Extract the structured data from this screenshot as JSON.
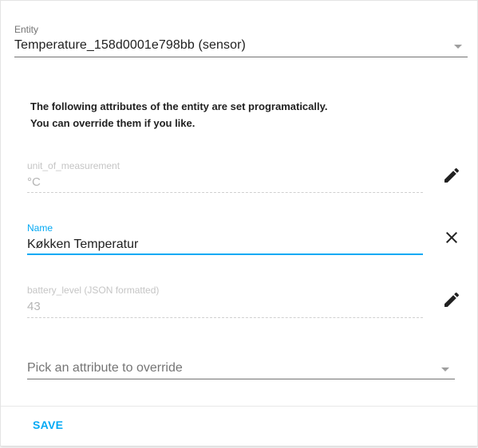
{
  "entity": {
    "label": "Entity",
    "value": "Temperature_158d0001e798bb (sensor)"
  },
  "notice": {
    "line1": "The following attributes of the entity are set programatically.",
    "line2": "You can override them if you like."
  },
  "attributes": {
    "unit": {
      "label": "unit_of_measurement",
      "value": "°C",
      "action_icon": "pencil-icon"
    },
    "name": {
      "label": "Name",
      "value": "Køkken Temperatur",
      "action_icon": "close-icon"
    },
    "battery": {
      "label": "battery_level (JSON formatted)",
      "value": "43",
      "action_icon": "pencil-icon"
    }
  },
  "pick_attribute": {
    "placeholder": "Pick an attribute to override"
  },
  "footer": {
    "save_label": "SAVE"
  },
  "colors": {
    "accent": "#03a9f4",
    "disabled_text": "#b5b5b5",
    "icon": "#212121"
  }
}
